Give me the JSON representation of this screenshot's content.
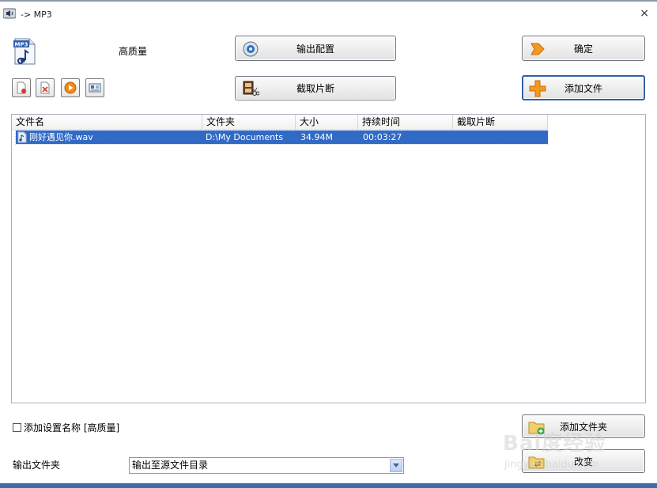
{
  "window": {
    "title": "-> MP3",
    "close_glyph": "×"
  },
  "preset": {
    "icon": "mp3-file-icon",
    "icon_label": "MP3",
    "quality": "高质量"
  },
  "buttons": {
    "output_config": "输出配置",
    "clip_segment": "截取片断",
    "ok": "确定",
    "add_file": "添加文件",
    "add_folder": "添加文件夹",
    "change": "改变"
  },
  "toolbar": [
    {
      "name": "remove-file-icon"
    },
    {
      "name": "clear-list-icon"
    },
    {
      "name": "play-icon"
    },
    {
      "name": "media-info-icon"
    }
  ],
  "file_list": {
    "columns": [
      "文件名",
      "文件夹",
      "大小",
      "持续时间",
      "截取片断"
    ],
    "rows": [
      {
        "name": "刚好遇见你.wav",
        "folder": "D:\\My Documents",
        "size": "34.94M",
        "duration": "00:03:27",
        "clip": ""
      }
    ]
  },
  "options": {
    "add_setting_name_label": "添加设置名称 [高质量]",
    "add_setting_name_checked": false
  },
  "output": {
    "label": "输出文件夹",
    "selected": "输出至源文件目录"
  },
  "watermark": {
    "text": "Bai度经验",
    "sub": "jingyan.baidu.com"
  },
  "colors": {
    "selection": "#316ac5",
    "focus_border": "#315fa8",
    "button_border": "#6f7680"
  }
}
